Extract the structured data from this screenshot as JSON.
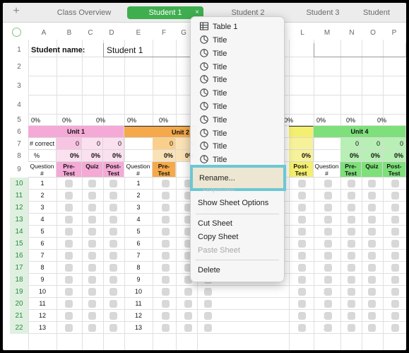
{
  "tabs": [
    {
      "label": "Class Overview",
      "active": false
    },
    {
      "label": "Student 1",
      "active": true
    },
    {
      "label": "Student 2",
      "active": false
    },
    {
      "label": "Student 3",
      "active": false
    },
    {
      "label": "Student",
      "active": false
    }
  ],
  "add_tab_symbol": "+",
  "close_symbol": "×",
  "columns": [
    "A",
    "B",
    "C",
    "D",
    "E",
    "F",
    "G",
    "L",
    "M",
    "N",
    "O",
    "P"
  ],
  "rows": [
    "1",
    "2",
    "3",
    "4",
    "5",
    "6",
    "7",
    "8",
    "9",
    "10",
    "11",
    "12",
    "13",
    "14",
    "15",
    "16",
    "17",
    "18",
    "19",
    "20",
    "21",
    "22"
  ],
  "sheet": {
    "student_name_label": "Student name:",
    "student_name_value": "Student 1",
    "pct": "0%",
    "zero": "0",
    "units": [
      "Unit 1",
      "Unit 2",
      "Unit 4"
    ],
    "unit_colors": {
      "unit1": "#f4a9d6",
      "unit2": "#f5a94a",
      "unit3": "#f5ef70",
      "unit4": "#7ee07a"
    },
    "labels": {
      "num_correct": "# correct",
      "percent": "%",
      "question_num": "Question #",
      "pre_test": "Pre-Test",
      "quiz": "Quiz",
      "post_test": "Post-Test"
    },
    "question_numbers": [
      "1",
      "2",
      "3",
      "4",
      "5",
      "6",
      "7",
      "8",
      "9",
      "10",
      "11",
      "12",
      "13"
    ]
  },
  "menu": {
    "table_item": "Table 1",
    "chart_items": [
      "Title",
      "Title",
      "Title",
      "Title",
      "Title",
      "Title",
      "Title",
      "Title",
      "Title",
      "Title"
    ],
    "rename": "Rename...",
    "hidden_item": "Duplicate",
    "show_options": "Show Sheet Options",
    "cut": "Cut Sheet",
    "copy": "Copy Sheet",
    "paste": "Paste Sheet",
    "delete": "Delete"
  },
  "highlight_color": "#6cc7d3",
  "icons": {
    "table": "table-icon",
    "chart": "pie-chart-icon"
  }
}
